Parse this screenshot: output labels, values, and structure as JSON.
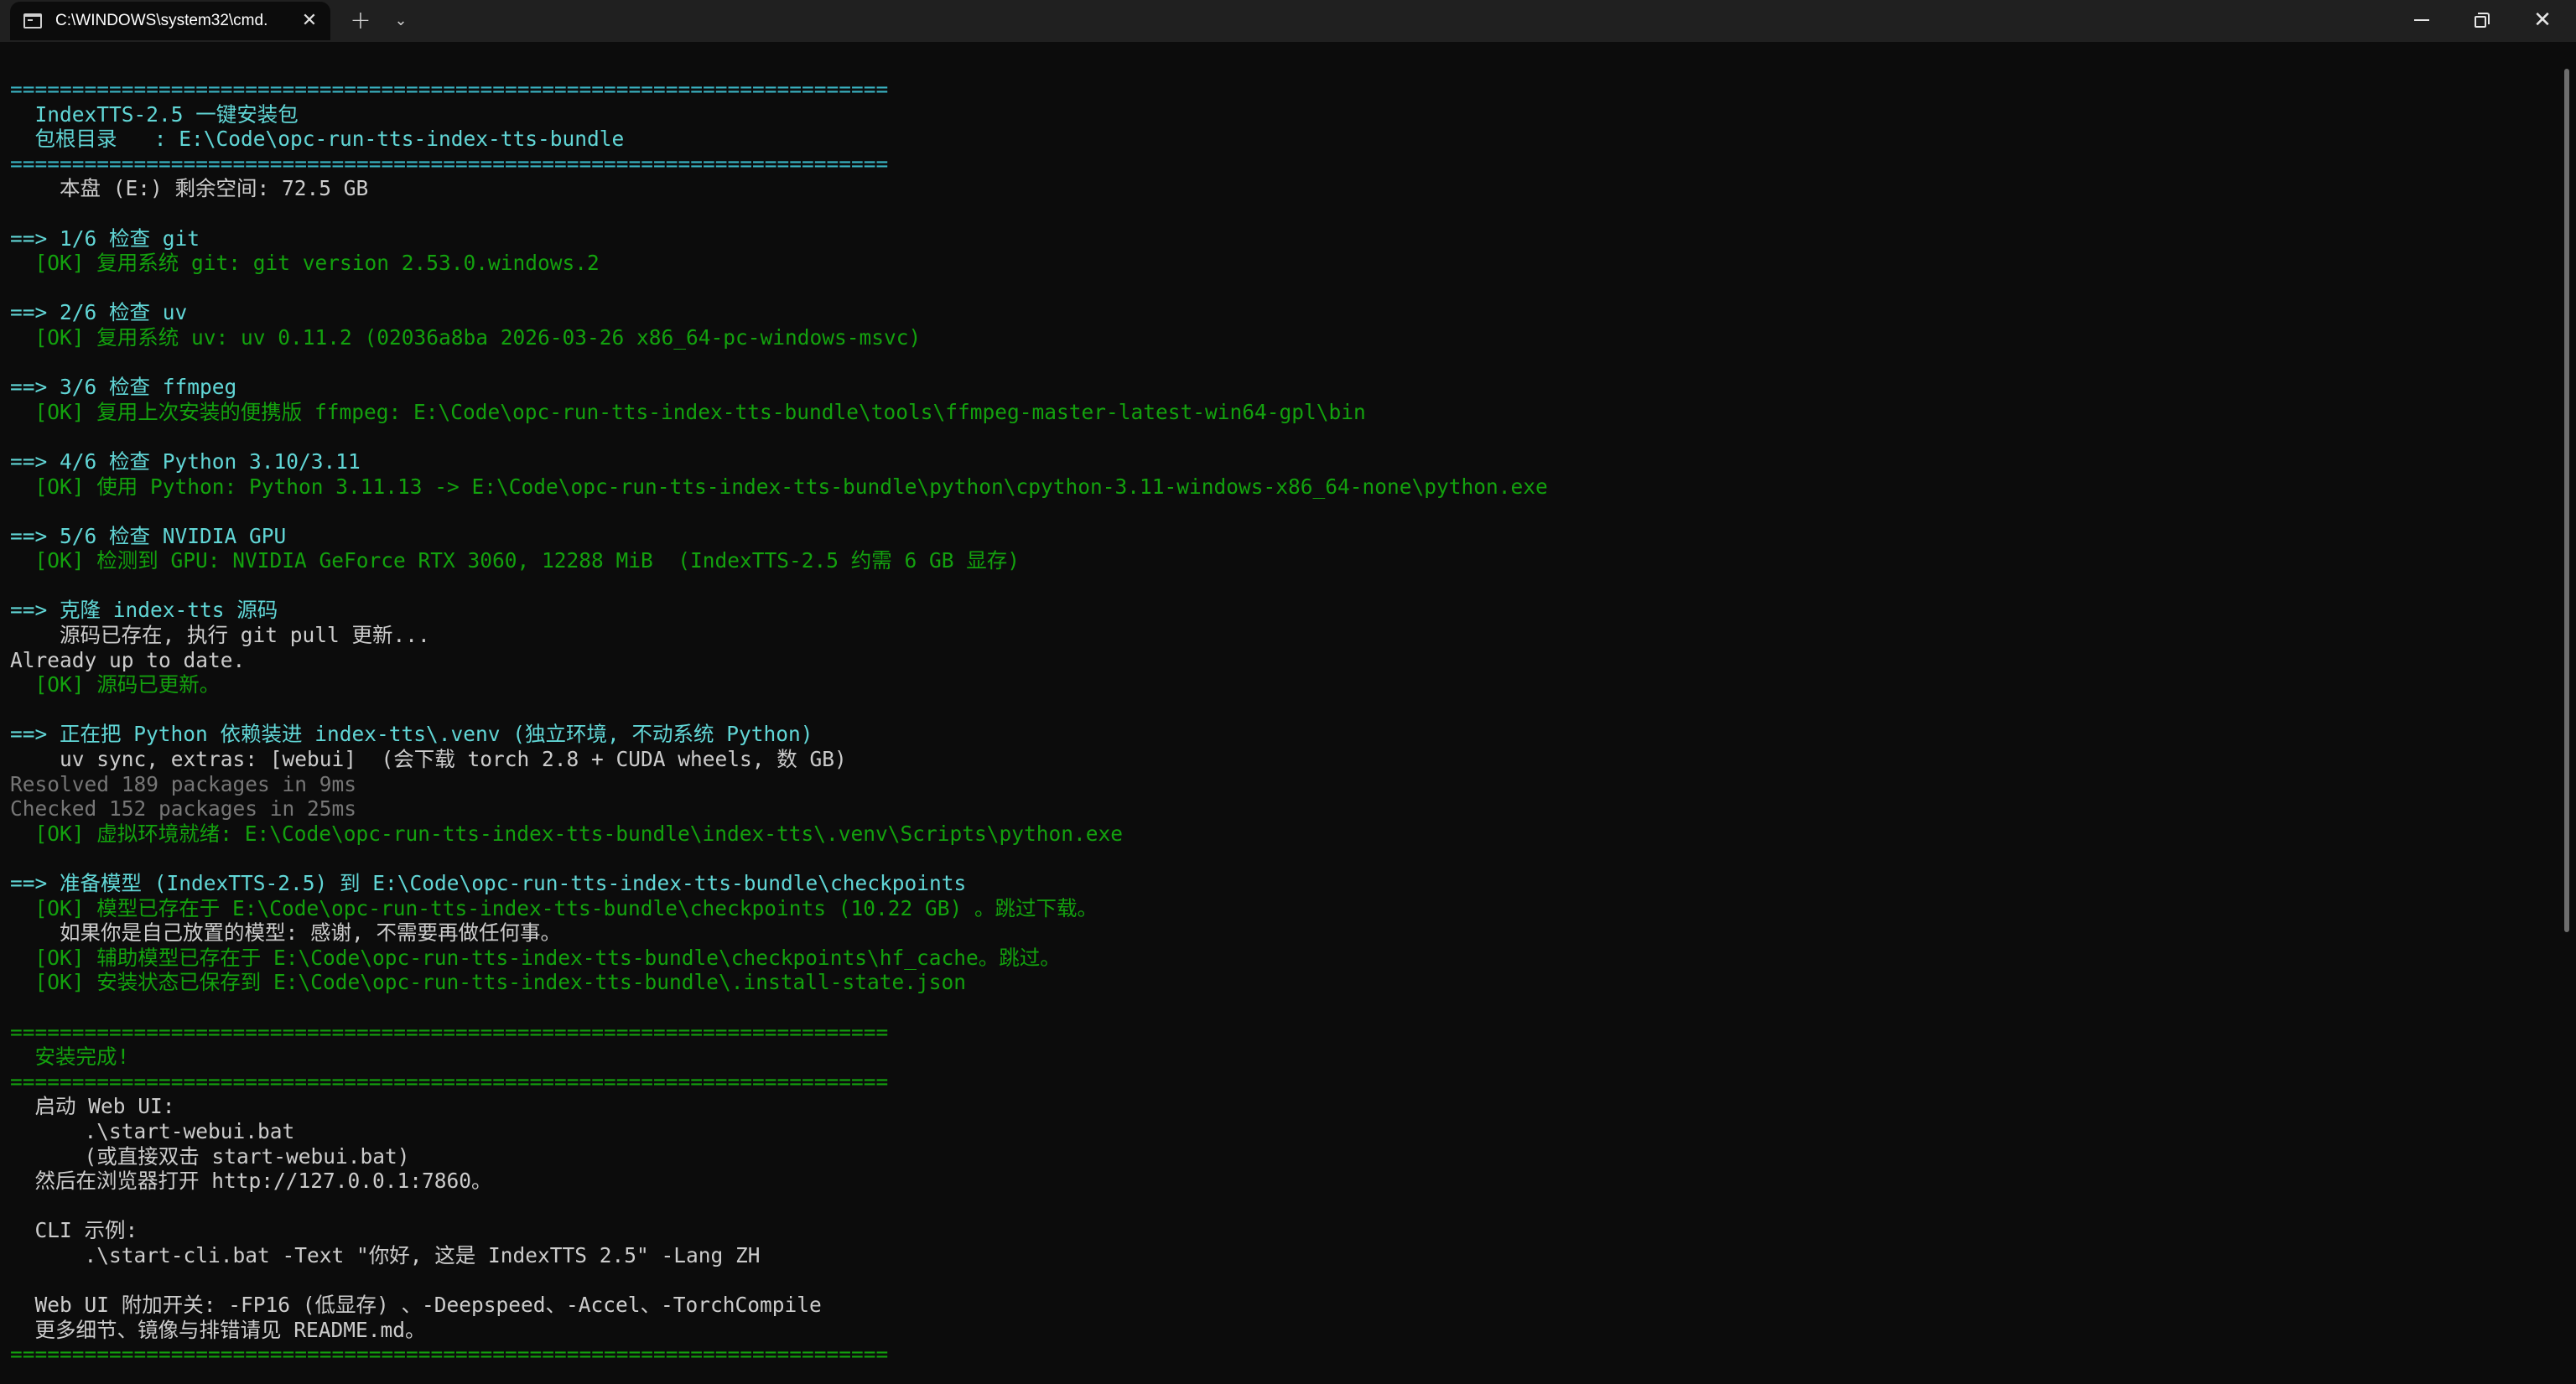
{
  "window": {
    "tab_title": "C:\\WINDOWS\\system32\\cmd.",
    "tab_close_glyph": "✕",
    "new_tab_glyph": "+",
    "dropdown_glyph": "⌄",
    "close_glyph": "✕"
  },
  "colors": {
    "background": "#0c0c0c",
    "titlebar": "#202020",
    "cyan": "#61d6d6",
    "green": "#13a10e",
    "white": "#cccccc",
    "gray": "#767676"
  },
  "icons": [
    "terminal-icon",
    "close-icon",
    "plus-icon",
    "chevron-down-icon",
    "minimize-icon",
    "restore-icon",
    "close-window-icon"
  ],
  "console": {
    "lines": [
      {
        "text": "=======================================================================",
        "color": "c-sep",
        "name": "separator-line"
      },
      {
        "text": "  IndexTTS-2.5 一键安装包",
        "color": "c-cyan",
        "name": "header-line"
      },
      {
        "text": "  包根目录   : E:\\Code\\opc-run-tts-index-tts-bundle",
        "color": "c-cyan",
        "name": "header-line"
      },
      {
        "text": "=======================================================================",
        "color": "c-sep",
        "name": "separator-line"
      },
      {
        "text": "    本盘 (E:) 剩余空间: 72.5 GB",
        "color": "c-white",
        "name": "output-line"
      },
      {
        "text": "",
        "color": "c-white",
        "name": "blank-line"
      },
      {
        "text": "==> 1/6 检查 git",
        "color": "c-cyan",
        "name": "step-line"
      },
      {
        "text": "  [OK] 复用系统 git: git version 2.53.0.windows.2",
        "color": "c-green",
        "name": "ok-line"
      },
      {
        "text": "",
        "color": "c-white",
        "name": "blank-line"
      },
      {
        "text": "==> 2/6 检查 uv",
        "color": "c-cyan",
        "name": "step-line"
      },
      {
        "text": "  [OK] 复用系统 uv: uv 0.11.2 (02036a8ba 2026-03-26 x86_64-pc-windows-msvc)",
        "color": "c-green",
        "name": "ok-line"
      },
      {
        "text": "",
        "color": "c-white",
        "name": "blank-line"
      },
      {
        "text": "==> 3/6 检查 ffmpeg",
        "color": "c-cyan",
        "name": "step-line"
      },
      {
        "text": "  [OK] 复用上次安装的便携版 ffmpeg: E:\\Code\\opc-run-tts-index-tts-bundle\\tools\\ffmpeg-master-latest-win64-gpl\\bin",
        "color": "c-green",
        "name": "ok-line"
      },
      {
        "text": "",
        "color": "c-white",
        "name": "blank-line"
      },
      {
        "text": "==> 4/6 检查 Python 3.10/3.11",
        "color": "c-cyan",
        "name": "step-line"
      },
      {
        "text": "  [OK] 使用 Python: Python 3.11.13 -> E:\\Code\\opc-run-tts-index-tts-bundle\\python\\cpython-3.11-windows-x86_64-none\\python.exe",
        "color": "c-green",
        "name": "ok-line"
      },
      {
        "text": "",
        "color": "c-white",
        "name": "blank-line"
      },
      {
        "text": "==> 5/6 检查 NVIDIA GPU",
        "color": "c-cyan",
        "name": "step-line"
      },
      {
        "text": "  [OK] 检测到 GPU: NVIDIA GeForce RTX 3060, 12288 MiB  (IndexTTS-2.5 约需 6 GB 显存)",
        "color": "c-green",
        "name": "ok-line"
      },
      {
        "text": "",
        "color": "c-white",
        "name": "blank-line"
      },
      {
        "text": "==> 克隆 index-tts 源码",
        "color": "c-cyan",
        "name": "step-line"
      },
      {
        "text": "    源码已存在, 执行 git pull 更新...",
        "color": "c-white",
        "name": "output-line"
      },
      {
        "text": "Already up to date.",
        "color": "c-white",
        "name": "output-line"
      },
      {
        "text": "  [OK] 源码已更新。",
        "color": "c-green",
        "name": "ok-line"
      },
      {
        "text": "",
        "color": "c-white",
        "name": "blank-line"
      },
      {
        "text": "==> 正在把 Python 依赖装进 index-tts\\.venv (独立环境, 不动系统 Python)",
        "color": "c-cyan",
        "name": "step-line"
      },
      {
        "text": "    uv sync, extras: [webui]  (会下载 torch 2.8 + CUDA wheels, 数 GB)",
        "color": "c-white",
        "name": "output-line"
      },
      {
        "text": "Resolved 189 packages in 9ms",
        "color": "c-gray",
        "name": "output-line"
      },
      {
        "text": "Checked 152 packages in 25ms",
        "color": "c-gray",
        "name": "output-line"
      },
      {
        "text": "  [OK] 虚拟环境就绪: E:\\Code\\opc-run-tts-index-tts-bundle\\index-tts\\.venv\\Scripts\\python.exe",
        "color": "c-green",
        "name": "ok-line"
      },
      {
        "text": "",
        "color": "c-white",
        "name": "blank-line"
      },
      {
        "text": "==> 准备模型 (IndexTTS-2.5) 到 E:\\Code\\opc-run-tts-index-tts-bundle\\checkpoints",
        "color": "c-cyan",
        "name": "step-line"
      },
      {
        "text": "  [OK] 模型已存在于 E:\\Code\\opc-run-tts-index-tts-bundle\\checkpoints (10.22 GB) 。跳过下载。",
        "color": "c-green",
        "name": "ok-line"
      },
      {
        "text": "    如果你是自己放置的模型: 感谢, 不需要再做任何事。",
        "color": "c-white",
        "name": "output-line"
      },
      {
        "text": "  [OK] 辅助模型已存在于 E:\\Code\\opc-run-tts-index-tts-bundle\\checkpoints\\hf_cache。跳过。",
        "color": "c-green",
        "name": "ok-line"
      },
      {
        "text": "  [OK] 安装状态已保存到 E:\\Code\\opc-run-tts-index-tts-bundle\\.install-state.json",
        "color": "c-green",
        "name": "ok-line"
      },
      {
        "text": "",
        "color": "c-white",
        "name": "blank-line"
      },
      {
        "text": "=======================================================================",
        "color": "c-green",
        "name": "separator-line"
      },
      {
        "text": "  安装完成!",
        "color": "c-green",
        "name": "success-line"
      },
      {
        "text": "=======================================================================",
        "color": "c-green",
        "name": "separator-line"
      },
      {
        "text": "  启动 Web UI:",
        "color": "c-white",
        "name": "output-line"
      },
      {
        "text": "      .\\start-webui.bat",
        "color": "c-white",
        "name": "output-line"
      },
      {
        "text": "      (或直接双击 start-webui.bat)",
        "color": "c-white",
        "name": "output-line"
      },
      {
        "text": "  然后在浏览器打开 http://127.0.0.1:7860。",
        "color": "c-white",
        "name": "output-line"
      },
      {
        "text": "",
        "color": "c-white",
        "name": "blank-line"
      },
      {
        "text": "  CLI 示例:",
        "color": "c-white",
        "name": "output-line"
      },
      {
        "text": "      .\\start-cli.bat -Text \"你好, 这是 IndexTTS 2.5\" -Lang ZH",
        "color": "c-white",
        "name": "output-line"
      },
      {
        "text": "",
        "color": "c-white",
        "name": "blank-line"
      },
      {
        "text": "  Web UI 附加开关: -FP16 (低显存) 、-Deepspeed、-Accel、-TorchCompile",
        "color": "c-white",
        "name": "output-line"
      },
      {
        "text": "  更多细节、镜像与排错请见 README.md。",
        "color": "c-white",
        "name": "output-line"
      },
      {
        "text": "=======================================================================",
        "color": "c-green",
        "name": "separator-line"
      }
    ]
  }
}
